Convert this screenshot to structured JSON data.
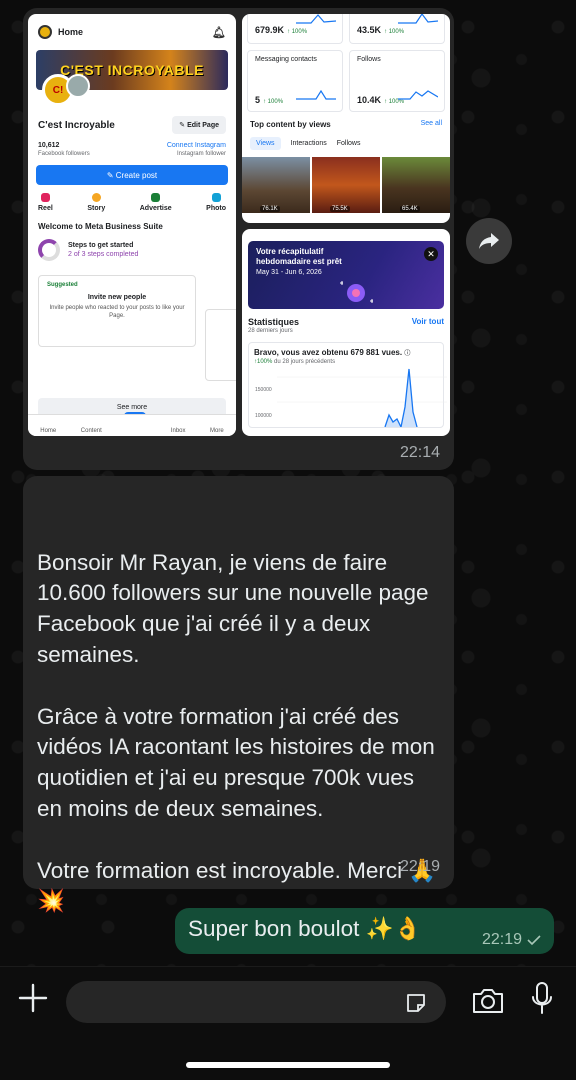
{
  "image_message": {
    "time": "22:14",
    "screenshot_home": {
      "title": "Home",
      "banner_text": "C'EST INCROYABLE",
      "page_name": "C'est Incroyable",
      "edit_button": "Edit Page",
      "followers_count": "10,612",
      "followers_label": "Facebook followers",
      "connect_instagram": "Connect Instagram",
      "instagram_follower": "Instagram follower",
      "create_post": "Create post",
      "actions": [
        "Reel",
        "Story",
        "Advertise",
        "Photo"
      ],
      "welcome": "Welcome to Meta Business Suite",
      "steps_title": "Steps to get started",
      "steps_sub": "2 of 3 steps completed",
      "suggested_badge": "Suggested",
      "suggested_title": "Invite new people",
      "suggested_sub": "Invite people who reacted to your posts to like your Page.",
      "see_more": "See more",
      "nav": [
        "Home",
        "Content",
        "Inbox",
        "More"
      ]
    },
    "screenshot_insights": {
      "metrics": [
        {
          "label": "",
          "value": "679.9K",
          "pct": "↑ 100%"
        },
        {
          "label": "",
          "value": "43.5K",
          "pct": "↑ 100%"
        },
        {
          "label": "Messaging contacts",
          "value": "5",
          "pct": "↑ 100%"
        },
        {
          "label": "Follows",
          "value": "10.4K",
          "pct": "↑ 100%"
        }
      ],
      "top_content_title": "Top content by views",
      "see_all": "See all",
      "tabs": [
        "Views",
        "Interactions",
        "Follows"
      ],
      "thumb_views": [
        "76.1K",
        "75.5K",
        "65.4K"
      ]
    },
    "screenshot_stats": {
      "recap_title": "Votre récapitulatif hebdomadaire est prêt",
      "recap_dates": "May 31 - Jun 6, 2026",
      "stats_title": "Statistiques",
      "stats_period": "28 derniers jours",
      "see_all": "Voir tout",
      "headline": "Bravo, vous avez obtenu 679 881 vues.",
      "change": "↑100%",
      "change_sub": "du 28 jours précédents",
      "y_ticks": [
        "150000",
        "100000"
      ]
    }
  },
  "text_message": {
    "body": "Bonsoir Mr Rayan, je viens de faire 10.600 followers sur une nouvelle page Facebook que j'ai créé il y a deux semaines.\n\nGrâce à votre formation j'ai créé des vidéos IA racontant les histoires de mon quotidien et j'ai eu presque 700k vues en moins de deux semaines.\n\nVotre formation est incroyable. Merci 🙏 💥",
    "time": "22:19"
  },
  "outgoing_message": {
    "body": "Super bon boulot ✨👌",
    "time": "22:19"
  },
  "colors": {
    "incoming_bubble": "#262626",
    "outgoing_bubble": "#144d37",
    "facebook_blue": "#1877f2"
  }
}
